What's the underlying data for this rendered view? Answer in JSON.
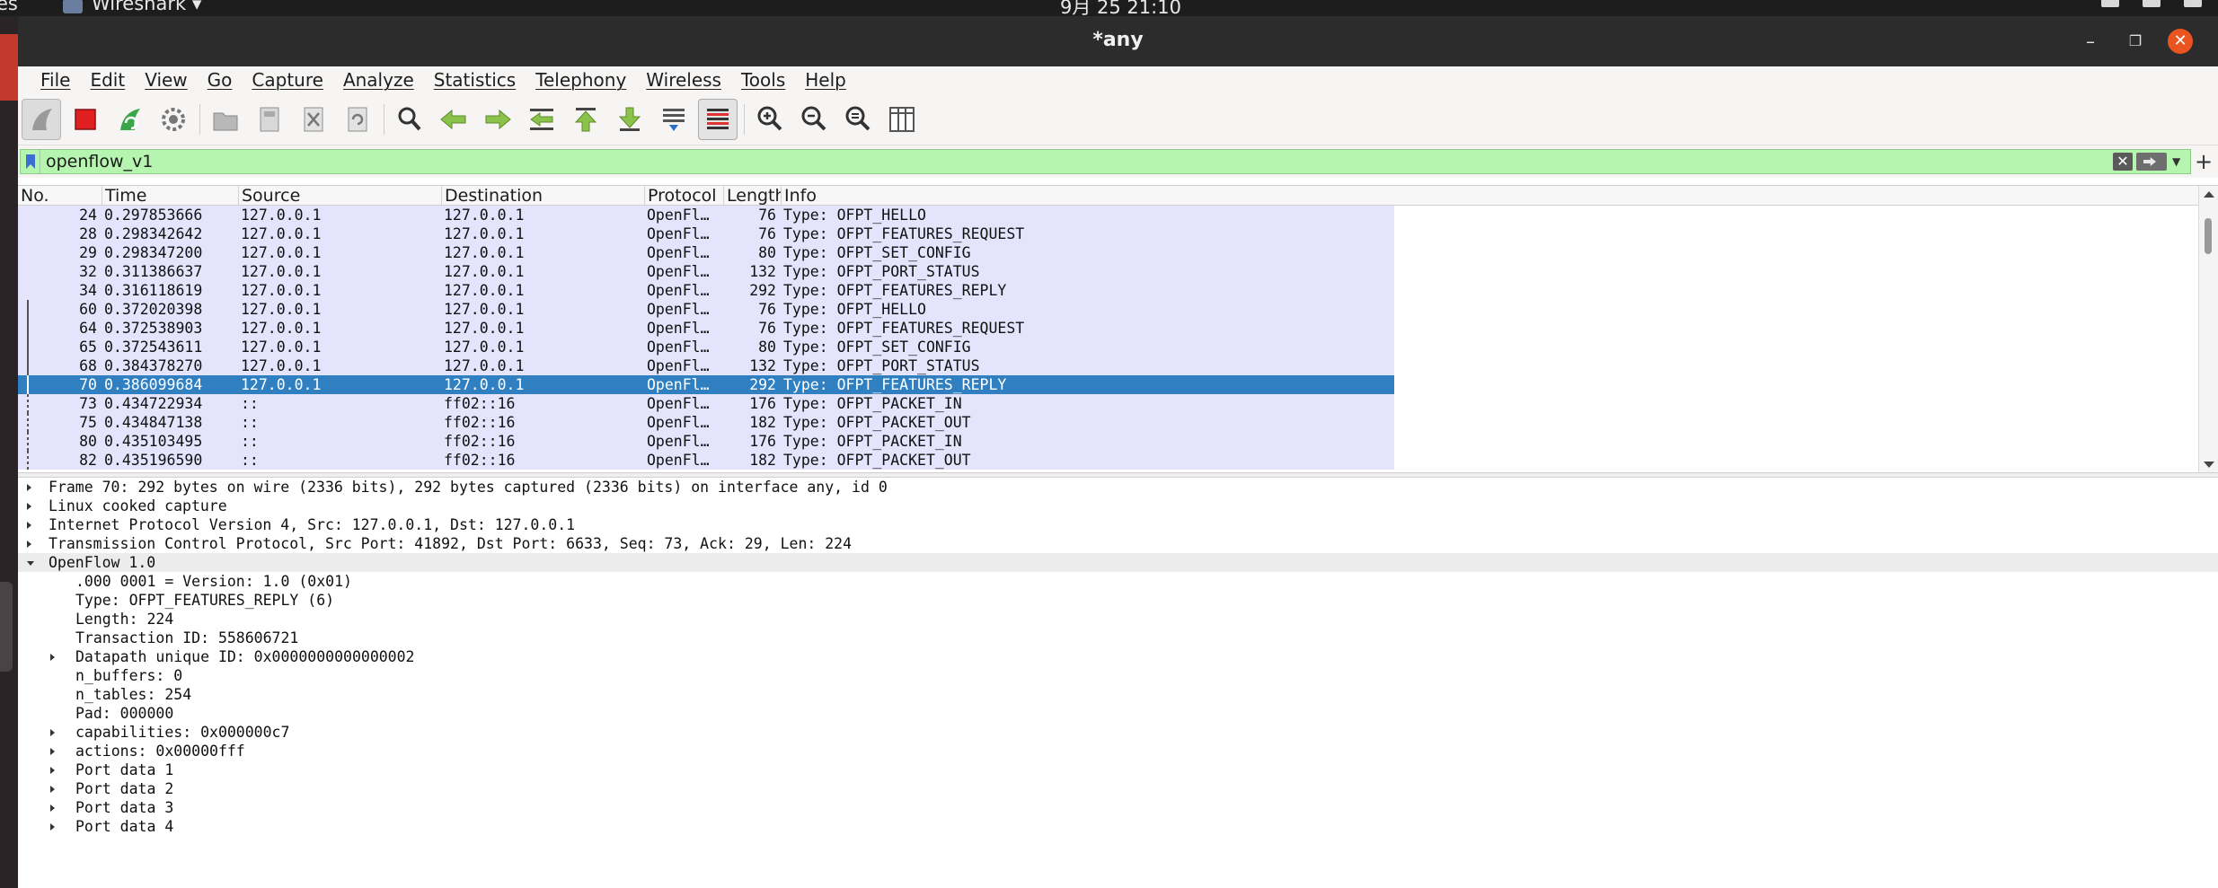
{
  "system_bar": {
    "activities": "es",
    "app_menu": "Wireshark ▾",
    "clock": "9月 25  21:10"
  },
  "window": {
    "title": "*any"
  },
  "menu": [
    "File",
    "Edit",
    "View",
    "Go",
    "Capture",
    "Analyze",
    "Statistics",
    "Telephony",
    "Wireless",
    "Tools",
    "Help"
  ],
  "toolbar": {
    "icons": [
      "start-capture-icon",
      "stop-capture-icon",
      "restart-capture-icon",
      "capture-options-icon",
      "open-file-icon",
      "save-file-icon",
      "close-file-icon",
      "reload-file-icon",
      "find-packet-icon",
      "go-back-icon",
      "go-forward-icon",
      "go-to-packet-icon",
      "go-first-icon",
      "go-last-icon",
      "auto-scroll-icon",
      "colorize-icon",
      "zoom-in-icon",
      "zoom-out-icon",
      "zoom-normal-icon",
      "resize-columns-icon"
    ]
  },
  "filter": {
    "value": "openflow_v1"
  },
  "packet_list": {
    "columns": [
      "No.",
      "Time",
      "Source",
      "Destination",
      "Protocol",
      "Length",
      "Info"
    ],
    "rows": [
      {
        "no": "24",
        "time": "0.297853666",
        "src": "127.0.0.1",
        "dst": "127.0.0.1",
        "proto": "OpenFl…",
        "len": "76",
        "info": "Type: OFPT_HELLO"
      },
      {
        "no": "28",
        "time": "0.298342642",
        "src": "127.0.0.1",
        "dst": "127.0.0.1",
        "proto": "OpenFl…",
        "len": "76",
        "info": "Type: OFPT_FEATURES_REQUEST"
      },
      {
        "no": "29",
        "time": "0.298347200",
        "src": "127.0.0.1",
        "dst": "127.0.0.1",
        "proto": "OpenFl…",
        "len": "80",
        "info": "Type: OFPT_SET_CONFIG"
      },
      {
        "no": "32",
        "time": "0.311386637",
        "src": "127.0.0.1",
        "dst": "127.0.0.1",
        "proto": "OpenFl…",
        "len": "132",
        "info": "Type: OFPT_PORT_STATUS"
      },
      {
        "no": "34",
        "time": "0.316118619",
        "src": "127.0.0.1",
        "dst": "127.0.0.1",
        "proto": "OpenFl…",
        "len": "292",
        "info": "Type: OFPT_FEATURES_REPLY"
      },
      {
        "no": "60",
        "time": "0.372020398",
        "src": "127.0.0.1",
        "dst": "127.0.0.1",
        "proto": "OpenFl…",
        "len": "76",
        "info": "Type: OFPT_HELLO"
      },
      {
        "no": "64",
        "time": "0.372538903",
        "src": "127.0.0.1",
        "dst": "127.0.0.1",
        "proto": "OpenFl…",
        "len": "76",
        "info": "Type: OFPT_FEATURES_REQUEST"
      },
      {
        "no": "65",
        "time": "0.372543611",
        "src": "127.0.0.1",
        "dst": "127.0.0.1",
        "proto": "OpenFl…",
        "len": "80",
        "info": "Type: OFPT_SET_CONFIG"
      },
      {
        "no": "68",
        "time": "0.384378270",
        "src": "127.0.0.1",
        "dst": "127.0.0.1",
        "proto": "OpenFl…",
        "len": "132",
        "info": "Type: OFPT_PORT_STATUS"
      },
      {
        "no": "70",
        "time": "0.386099684",
        "src": "127.0.0.1",
        "dst": "127.0.0.1",
        "proto": "OpenFl…",
        "len": "292",
        "info": "Type: OFPT_FEATURES_REPLY",
        "selected": true
      },
      {
        "no": "73",
        "time": "0.434722934",
        "src": "::",
        "dst": "ff02::16",
        "proto": "OpenFl…",
        "len": "176",
        "info": "Type: OFPT_PACKET_IN"
      },
      {
        "no": "75",
        "time": "0.434847138",
        "src": "::",
        "dst": "ff02::16",
        "proto": "OpenFl…",
        "len": "182",
        "info": "Type: OFPT_PACKET_OUT"
      },
      {
        "no": "80",
        "time": "0.435103495",
        "src": "::",
        "dst": "ff02::16",
        "proto": "OpenFl…",
        "len": "176",
        "info": "Type: OFPT_PACKET_IN"
      },
      {
        "no": "82",
        "time": "0.435196590",
        "src": "::",
        "dst": "ff02::16",
        "proto": "OpenFl…",
        "len": "182",
        "info": "Type: OFPT_PACKET_OUT"
      }
    ],
    "colors": {
      "row_bg": "#e4e4fc",
      "selected_bg": "#2f7fc1"
    }
  },
  "details": [
    {
      "text": "Frame 70: 292 bytes on wire (2336 bits), 292 bytes captured (2336 bits) on interface any, id 0",
      "level": 0,
      "arrow": "right"
    },
    {
      "text": "Linux cooked capture",
      "level": 0,
      "arrow": "right"
    },
    {
      "text": "Internet Protocol Version 4, Src: 127.0.0.1, Dst: 127.0.0.1",
      "level": 0,
      "arrow": "right"
    },
    {
      "text": "Transmission Control Protocol, Src Port: 41892, Dst Port: 6633, Seq: 73, Ack: 29, Len: 224",
      "level": 0,
      "arrow": "right"
    },
    {
      "text": "OpenFlow 1.0",
      "level": 0,
      "arrow": "down",
      "highlight": true
    },
    {
      "text": ".000 0001 = Version: 1.0 (0x01)",
      "level": 1,
      "arrow": ""
    },
    {
      "text": "Type: OFPT_FEATURES_REPLY (6)",
      "level": 1,
      "arrow": ""
    },
    {
      "text": "Length: 224",
      "level": 1,
      "arrow": ""
    },
    {
      "text": "Transaction ID: 558606721",
      "level": 1,
      "arrow": ""
    },
    {
      "text": "Datapath unique ID: 0x0000000000000002",
      "level": 1,
      "arrow": "right"
    },
    {
      "text": "n_buffers: 0",
      "level": 1,
      "arrow": ""
    },
    {
      "text": "n_tables: 254",
      "level": 1,
      "arrow": ""
    },
    {
      "text": "Pad: 000000",
      "level": 1,
      "arrow": ""
    },
    {
      "text": "capabilities: 0x000000c7",
      "level": 1,
      "arrow": "right"
    },
    {
      "text": "actions: 0x00000fff",
      "level": 1,
      "arrow": "right"
    },
    {
      "text": "Port data 1",
      "level": 1,
      "arrow": "right"
    },
    {
      "text": "Port data 2",
      "level": 1,
      "arrow": "right"
    },
    {
      "text": "Port data 3",
      "level": 1,
      "arrow": "right"
    },
    {
      "text": "Port data 4",
      "level": 1,
      "arrow": "right"
    }
  ]
}
